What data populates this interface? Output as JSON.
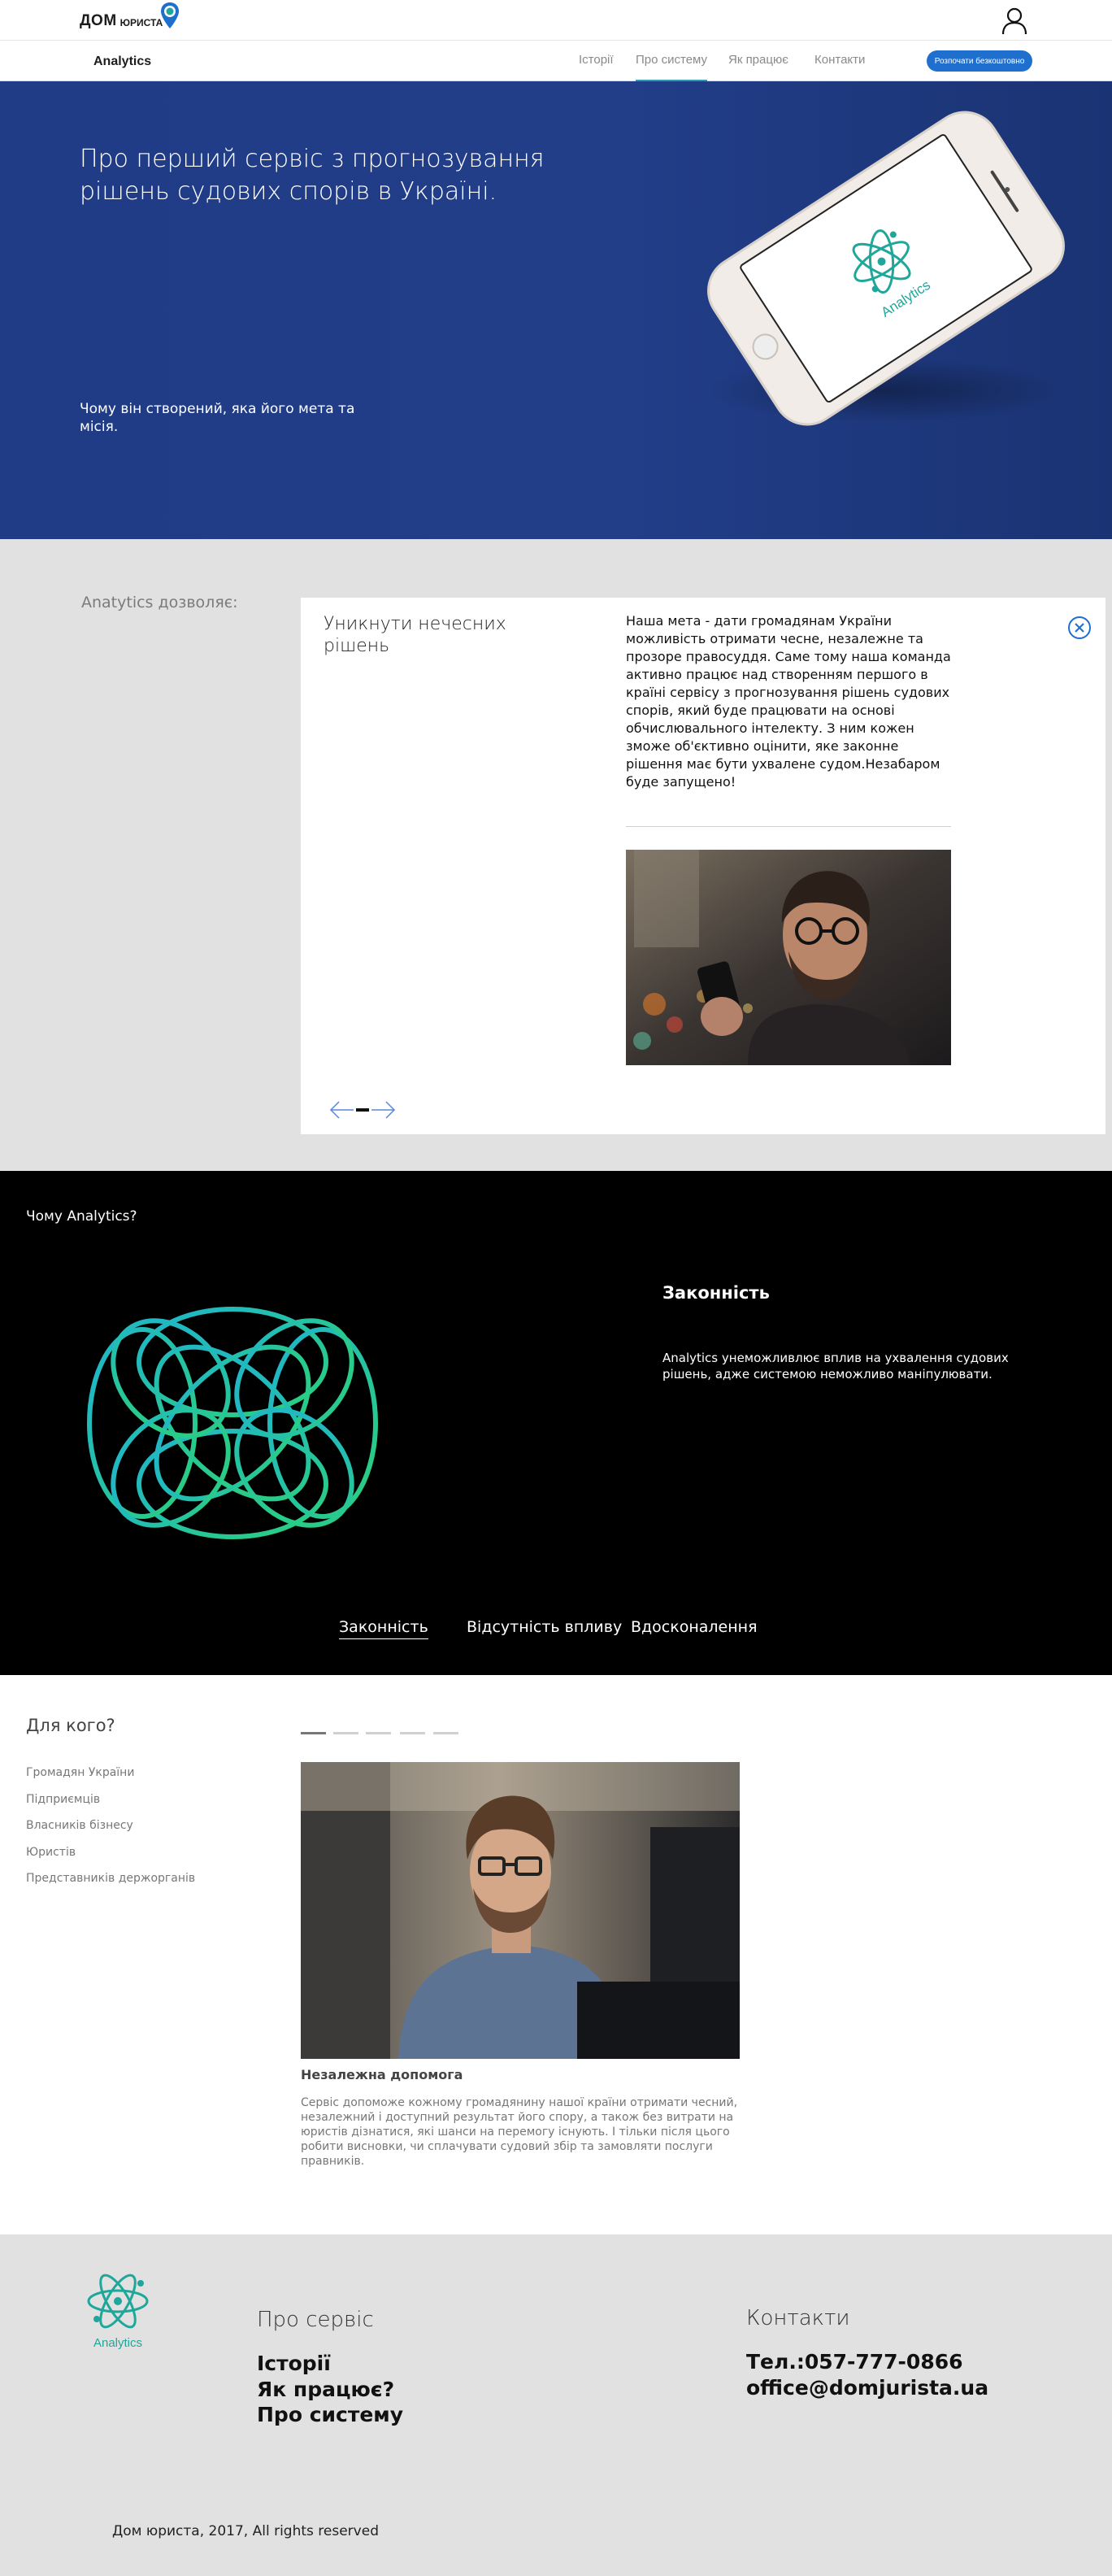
{
  "header": {
    "logo_dom": "ДОМ",
    "logo_jurista": "ЮРИСТА",
    "brand": "Analytics",
    "nav": [
      "Історії",
      "Про систему",
      "Як працює",
      "Контакти"
    ],
    "active_nav": 1,
    "cta": "Розпочати безкоштовно"
  },
  "hero": {
    "title": "Про перший сервіс з прогнозування рішень судових спорів в Україні.",
    "subtitle": "Чому він створений, яка його мета та місія.",
    "phone_logo_text": "Analytics"
  },
  "allows": {
    "title": "Anatytics дозволяє:",
    "card_heading": "Уникнути нечесних рішень",
    "card_text": "Наша мета - дати громадянам України можливість отримати чесне, незалежне та прозоре правосуддя. Саме тому наша команда активно працює над створенням першого в країні сервісу з прогнозування рішень судових спорів, який буде працювати на основі обчислювального інтелекту. З ним кожен зможе об'єктивно оцінити, яке законне рішення має бути ухвалене судом.Незабаром буде запущено!"
  },
  "why": {
    "title": "Чому Analytics?",
    "heading": "Законність",
    "text": "Analytics унеможливлює вплив на ухвалення судових рішень, адже системою неможливо маніпулювати.",
    "tabs": [
      "Законність",
      "Відсутність впливу",
      "Вдосконалення"
    ]
  },
  "forwho": {
    "title": "Для кого?",
    "items": [
      "Громадян України",
      "Підприємців",
      "Власників бізнесу",
      "Юристів",
      "Представників держорганів"
    ],
    "heading": "Незалежна допомога",
    "text": "Сервіс допоможе кожному громадянину нашої країни отримати чесний, незалежний і доступний результат його спору, а також без витрати на юристів дізнатися, які шанси на перемогу існують. І тільки після цього робити висновки, чи сплачувати судовий збір та замовляти послуги правників."
  },
  "footer": {
    "logo_text": "Analytics",
    "service_title": "Про сервіс",
    "links": [
      "Історії",
      "Як працює?",
      "Про систему"
    ],
    "contacts_title": "Контакти",
    "phone": "Тел.:057-777-0866",
    "email": "office@domjurista.ua",
    "copyright": "Дом юриста, 2017, All rights reserved"
  },
  "colors": {
    "hero_bg": "#223e89",
    "accent_teal": "#1ea79a",
    "cta_blue": "#1f6fcf",
    "section_gray": "#e1e1e1"
  }
}
